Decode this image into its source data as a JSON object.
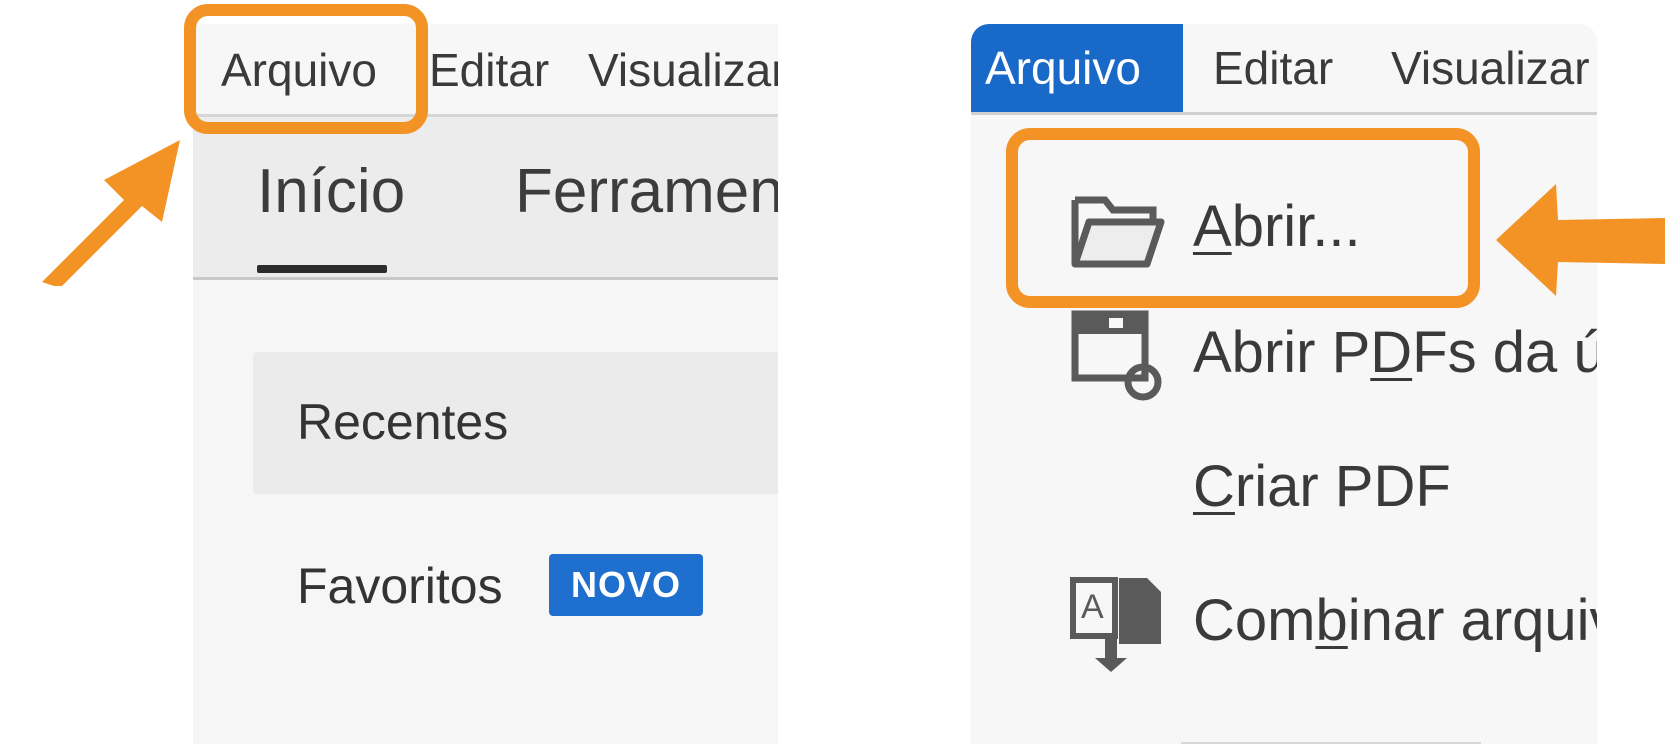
{
  "left": {
    "menubar": {
      "items": [
        "Arquivo",
        "Editar",
        "Visualizar"
      ]
    },
    "tabs": [
      "Início",
      "Ferrament"
    ],
    "nav": {
      "recentes": "Recentes",
      "favoritos": "Favoritos",
      "badge": "NOVO"
    }
  },
  "right": {
    "menubar": {
      "items": [
        "Arquivo",
        "Editar",
        "Visualizar"
      ]
    },
    "dropdown": [
      {
        "pre": "",
        "u": "A",
        "post": "brir...",
        "icon": "folder-open-icon"
      },
      {
        "pre": "Abrir P",
        "u": "D",
        "post": "Fs da úl",
        "icon": "reopen-pdfs-icon"
      },
      {
        "pre": "",
        "u": "C",
        "post": "riar PDF",
        "icon": ""
      },
      {
        "pre": "Com",
        "u": "b",
        "post": "inar arquiv",
        "icon": "combine-files-icon"
      }
    ]
  },
  "colors": {
    "highlight": "#f39325",
    "active_menu": "#1869c8",
    "badge": "#1f6fcf"
  }
}
